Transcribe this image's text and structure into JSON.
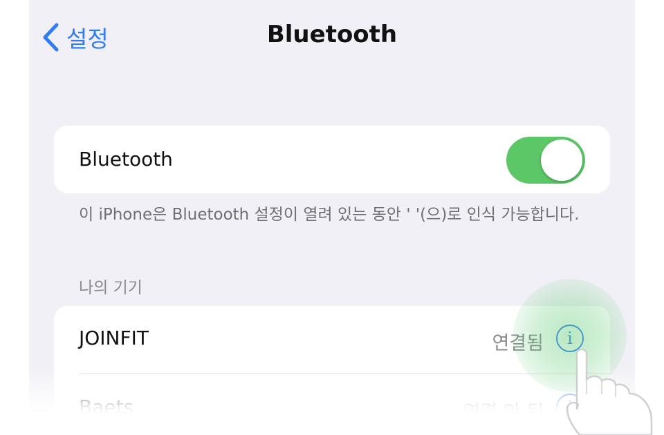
{
  "nav": {
    "back_label": "설정",
    "title": "Bluetooth"
  },
  "bluetooth": {
    "label": "Bluetooth",
    "enabled": true,
    "toggle_color": "#5cc767"
  },
  "footnote": "이 iPhone은 Bluetooth 설정이 열려 있는 동안 '            '(으)로 인식 가능합니다.",
  "section_header": "나의 기기",
  "devices": [
    {
      "name": "JOINFIT",
      "status": "연결됨",
      "info_icon": "info-circle-icon"
    },
    {
      "name": "Baets",
      "status": "연결 안 됨",
      "info_icon": "info-circle-icon"
    }
  ],
  "accent_color": "#2f7cf6",
  "overlay": {
    "pointer": "hand-pointer-icon",
    "highlight_color": "#64cd78"
  }
}
